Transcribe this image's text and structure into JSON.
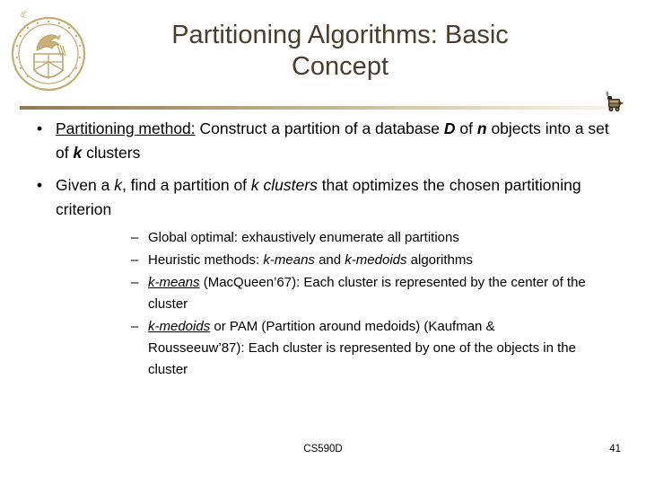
{
  "slide": {
    "background_color": "#ffffff",
    "title": "Partitioning Algorithms: Basic\nConcept",
    "title_color": "#4a3d2e",
    "logo_alt": "purdue-university-seal",
    "divider_gradient_from": "#8b7a55",
    "divider_gradient_to": "#f7f4ea",
    "divider_cap_icon": "locomotive-icon"
  },
  "bullets": [
    {
      "marker": "•",
      "level": 1,
      "parts": [
        {
          "text": "Partitioning method:",
          "style": "underline"
        },
        {
          "text": " Construct a partition of a database ",
          "style": "normal"
        },
        {
          "text": "D",
          "style": "bold-italic"
        },
        {
          "text": " of ",
          "style": "normal"
        },
        {
          "text": "n",
          "style": "bold-italic"
        },
        {
          "text": " objects into a set of ",
          "style": "normal"
        },
        {
          "text": "k",
          "style": "bold-italic"
        },
        {
          "text": " clusters",
          "style": "normal"
        }
      ]
    },
    {
      "marker": "•",
      "level": 1,
      "parts": [
        {
          "text": "Given a ",
          "style": "normal"
        },
        {
          "text": "k",
          "style": "italic"
        },
        {
          "text": ", find a partition of ",
          "style": "normal"
        },
        {
          "text": "k clusters",
          "style": "italic"
        },
        {
          "text": " that optimizes the chosen partitioning criterion",
          "style": "normal"
        }
      ]
    }
  ],
  "subbullets": [
    {
      "marker": "–",
      "level": 2,
      "parts": [
        {
          "text": "Global optimal: exhaustively enumerate all partitions",
          "style": "normal"
        }
      ]
    },
    {
      "marker": "–",
      "level": 2,
      "parts": [
        {
          "text": "Heuristic methods: ",
          "style": "normal"
        },
        {
          "text": "k-means",
          "style": "italic"
        },
        {
          "text": " and ",
          "style": "normal"
        },
        {
          "text": "k-medoids",
          "style": "italic"
        },
        {
          "text": " algorithms",
          "style": "normal"
        }
      ]
    },
    {
      "marker": "–",
      "level": 2,
      "parts": [
        {
          "text": "k-means",
          "style": "underline-italic"
        },
        {
          "text": " (MacQueen’67): Each cluster is represented by the center of the cluster",
          "style": "normal"
        }
      ]
    },
    {
      "marker": "–",
      "level": 2,
      "parts": [
        {
          "text": "k-medoids",
          "style": "underline-italic"
        },
        {
          "text": " or PAM (Partition around medoids) (Kaufman & Rousseeuw’87): Each cluster is represented by one of the objects in the cluster",
          "style": "normal"
        }
      ]
    }
  ],
  "footer": {
    "course": "CS590D",
    "page_number": "41"
  }
}
